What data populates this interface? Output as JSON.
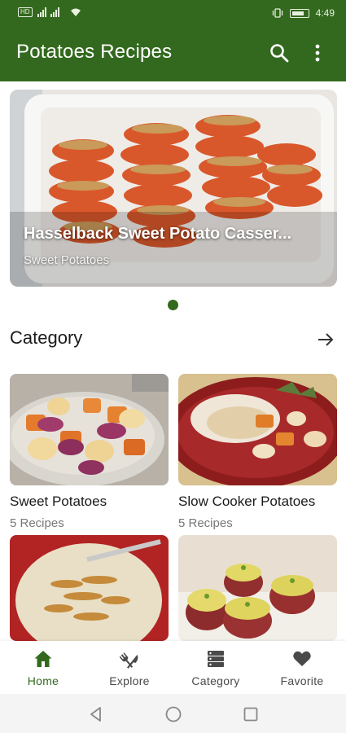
{
  "status_bar": {
    "left_badge": "HD",
    "time": "4:49"
  },
  "app_bar": {
    "title": "Potatoes Recipes",
    "icons": [
      "search-icon",
      "more-vert-icon"
    ]
  },
  "banner": {
    "title": "Hasselback Sweet Potato Casser...",
    "subtitle": "Sweet Potatoes"
  },
  "category_section": {
    "title": "Category",
    "icon": "arrow-right-icon",
    "items": [
      {
        "name": "Sweet Potatoes",
        "count": "5 Recipes"
      },
      {
        "name": "Slow Cooker Potatoes",
        "count": "5 Recipes"
      }
    ]
  },
  "bottom_nav": {
    "items": [
      {
        "label": "Home",
        "icon": "home-icon"
      },
      {
        "label": "Explore",
        "icon": "fork-knife-icon"
      },
      {
        "label": "Category",
        "icon": "category-list-icon"
      },
      {
        "label": "Favorite",
        "icon": "heart-icon"
      }
    ],
    "active": "Home"
  },
  "colors": {
    "primary": "#33691e",
    "text": "#1a1a1a",
    "muted": "#777777"
  }
}
